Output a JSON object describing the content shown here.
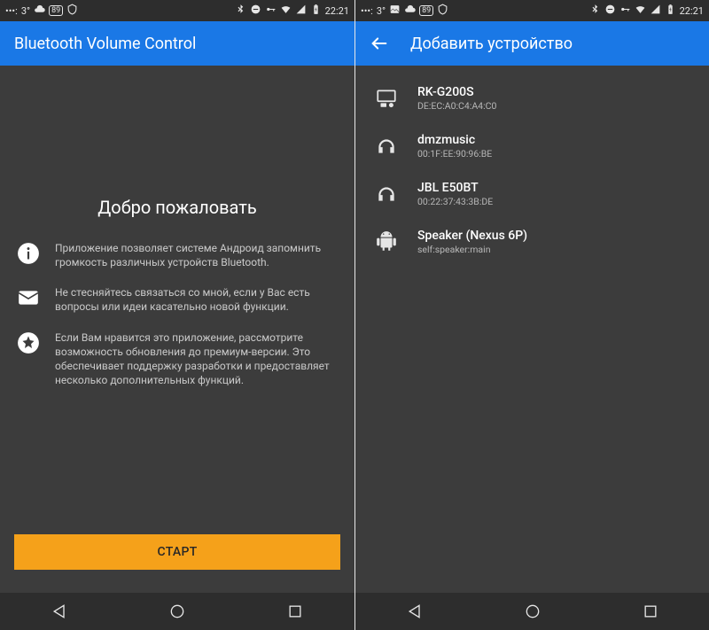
{
  "status": {
    "temp": "3°",
    "badge": "89",
    "time": "22:21"
  },
  "screen1": {
    "appbar_title": "Bluetooth Volume Control",
    "welcome": "Добро пожаловать",
    "features": [
      "Приложение позволяет системе Андроид запомнить громкость различных устройств Bluetooth.",
      "Не стесняйтесь связаться со мной, если у Вас есть вопросы или идеи касательно новой функции.",
      "Если Вам нравится это приложение, рассмотрите возможность обновления до премиум-версии. Это обеспечивает поддержку разработки и предоставляет несколько дополнительных функций."
    ],
    "start_label": "СТАРТ"
  },
  "screen2": {
    "appbar_title": "Добавить устройство",
    "devices": [
      {
        "name": "RK-G200S",
        "sub": "DE:EC:A0:C4:A4:C0",
        "icon": "display"
      },
      {
        "name": "dmzmusic",
        "sub": "00:1F:EE:90:96:BE",
        "icon": "headphones"
      },
      {
        "name": "JBL E50BT",
        "sub": "00:22:37:43:3B:DE",
        "icon": "headphones"
      },
      {
        "name": "Speaker (Nexus 6P)",
        "sub": "self:speaker:main",
        "icon": "android"
      }
    ]
  }
}
